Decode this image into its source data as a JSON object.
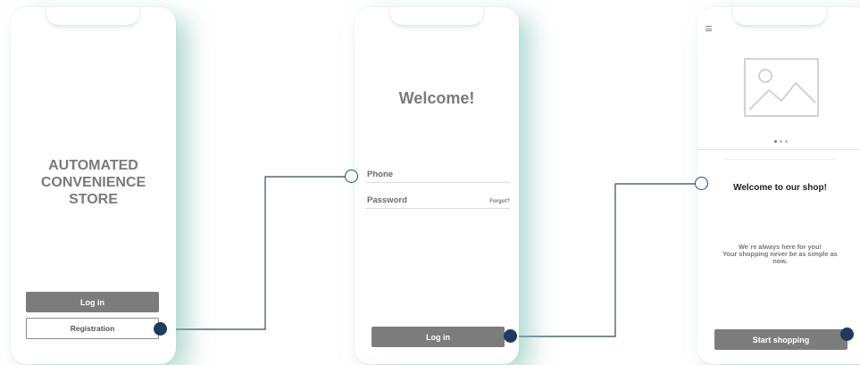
{
  "screen1": {
    "title_lines": [
      "AUTOMATED",
      "CONVENIENCE",
      "STORE"
    ],
    "login_button": "Log in",
    "registration_button": "Registration"
  },
  "screen2": {
    "title": "Welcome!",
    "phone_label": "Phone",
    "password_label": "Password",
    "forgot_link": "Forgot?",
    "login_button": "Log in"
  },
  "screen3": {
    "menu_icon": "hamburger-menu-icon",
    "image_icon": "image-placeholder-icon",
    "carousel_dots": 3,
    "heading": "Welcome to our shop!",
    "message_lines": [
      "We`re always here for you!",
      "Your shopping never be as simple as",
      "now."
    ],
    "start_button": "Start shopping"
  },
  "colors": {
    "button_gray": "#7c7c7c",
    "connector": "#1f3a5a",
    "shadow_teal": "#78beaf"
  }
}
